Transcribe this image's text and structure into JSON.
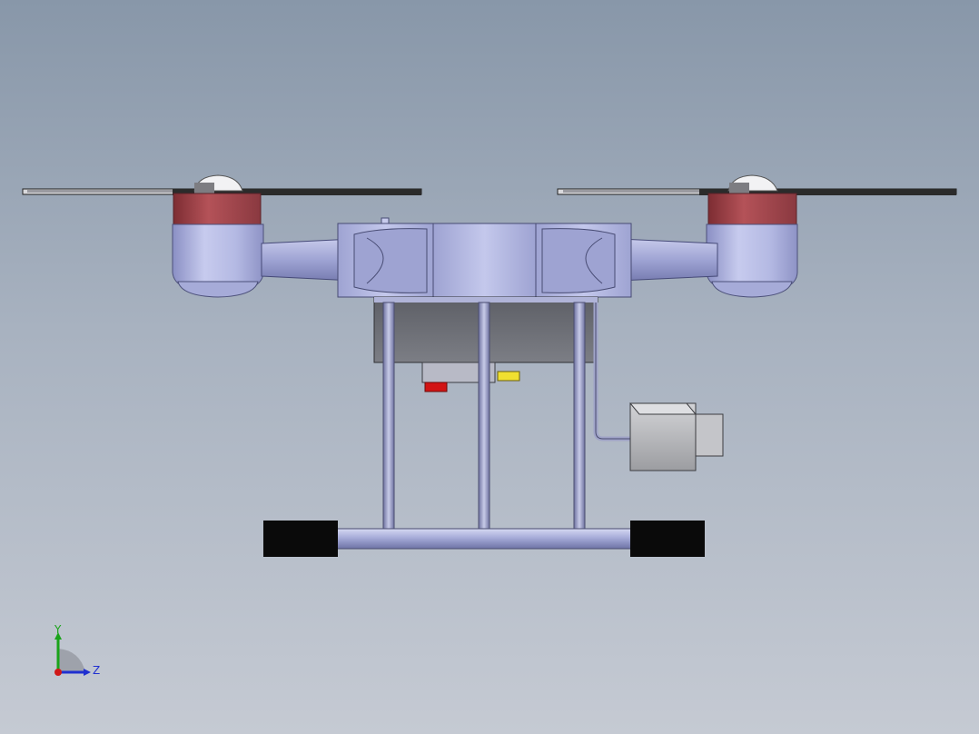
{
  "view": {
    "background_top": "#8897a9",
    "background_bottom": "#c5cad3"
  },
  "model": {
    "colors": {
      "motor_band": "#a4474b",
      "motor_housing": "#b9bfe6",
      "tube": "#a9aed9",
      "hub": "#b4b9e0",
      "blade": "#2b2b2b",
      "battery_box": "#74767c",
      "skid": "#0a0a0a",
      "camera": "#b9babd",
      "red_led": "#d21414",
      "yellow_part": "#f0e030"
    }
  },
  "triad": {
    "y_label": "Y",
    "z_label": "Z",
    "y_color": "#1aa31a",
    "z_color": "#2030d0",
    "x_color": "#d01818"
  }
}
